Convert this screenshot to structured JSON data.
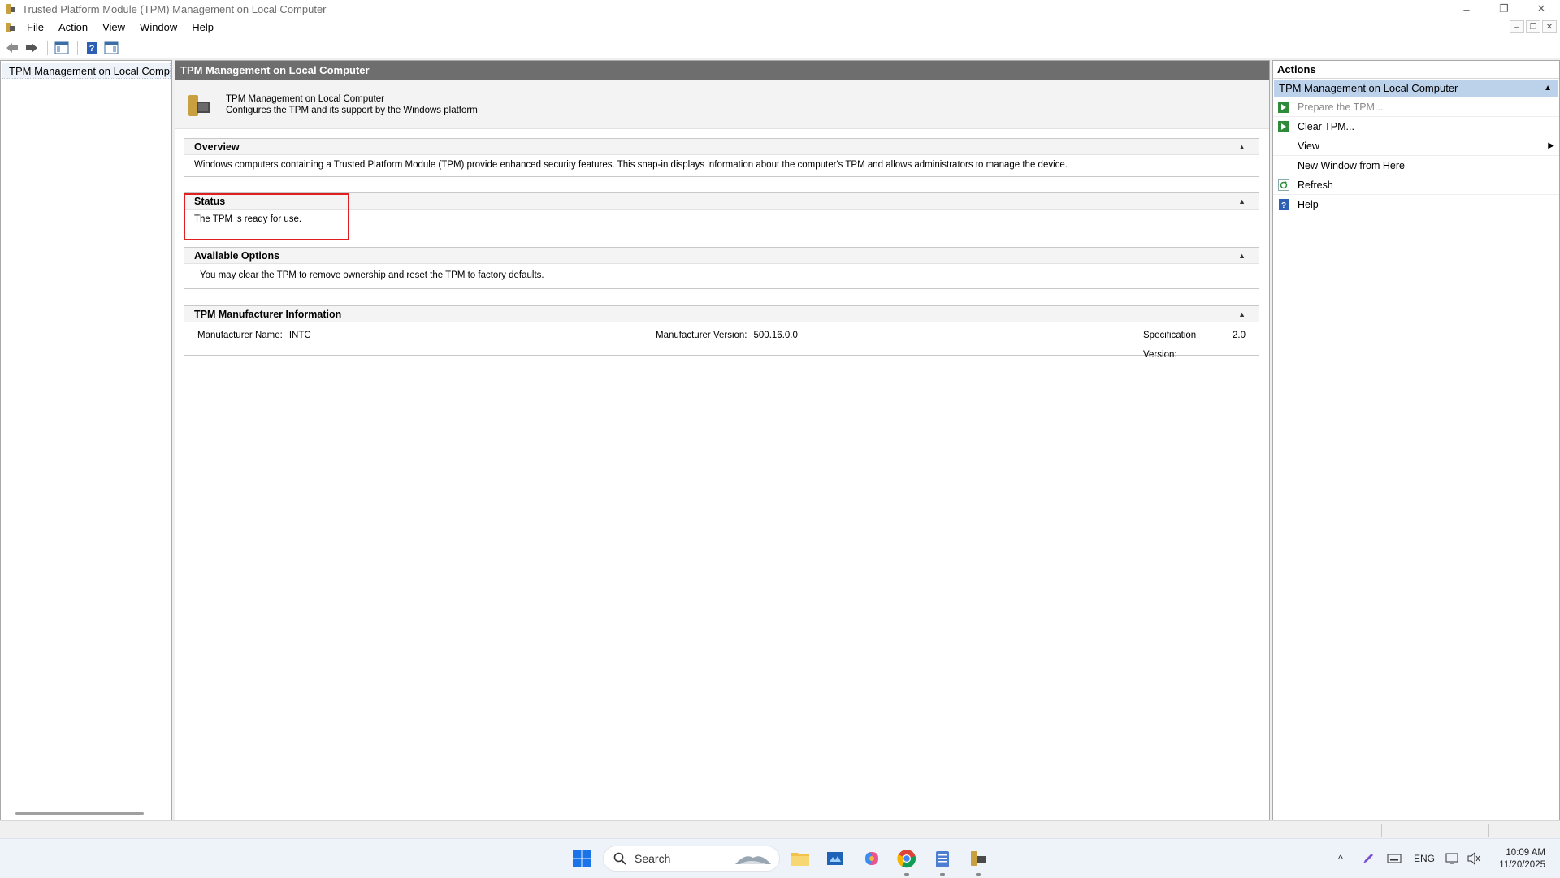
{
  "window": {
    "title": "Trusted Platform Module (TPM) Management on Local Computer",
    "controls": {
      "minimize": "–",
      "restore": "❐",
      "close": "✕"
    }
  },
  "menu": {
    "items": [
      "File",
      "Action",
      "View",
      "Window",
      "Help"
    ]
  },
  "tree": {
    "root_label": "TPM Management on Local Comp"
  },
  "center": {
    "header": "TPM Management on Local Computer",
    "desc_title": "TPM Management on Local Computer",
    "desc_subtitle": "Configures the TPM and its support by the Windows platform",
    "sections": {
      "overview": {
        "title": "Overview",
        "body": "Windows computers containing a Trusted Platform Module (TPM) provide enhanced security features. This snap-in displays information about the computer's TPM and allows administrators to manage the device."
      },
      "status": {
        "title": "Status",
        "body": "The TPM is ready for use."
      },
      "options": {
        "title": "Available Options",
        "body": "You may clear the TPM to remove ownership and reset the TPM to factory defaults."
      },
      "manufacturer": {
        "title": "TPM Manufacturer Information",
        "name_label": "Manufacturer Name:",
        "name_value": "INTC",
        "version_label": "Manufacturer Version:",
        "version_value": "500.16.0.0",
        "spec_label": "Specification Version:",
        "spec_value": "2.0"
      }
    }
  },
  "actions": {
    "header": "Actions",
    "group": "TPM Management on Local Computer",
    "items": {
      "prepare": "Prepare the TPM...",
      "clear": "Clear TPM...",
      "view": "View",
      "new_window": "New Window from Here",
      "refresh": "Refresh",
      "help": "Help"
    }
  },
  "taskbar": {
    "search_placeholder": "Search",
    "language": "ENG",
    "time": "10:09 AM",
    "date": "11/20/2025"
  },
  "colors": {
    "center_header_bg": "#6e6e6e",
    "actions_group_bg": "#bcd1ea",
    "highlight_border": "#e02020",
    "taskbar_bg": "#eef3fa"
  }
}
